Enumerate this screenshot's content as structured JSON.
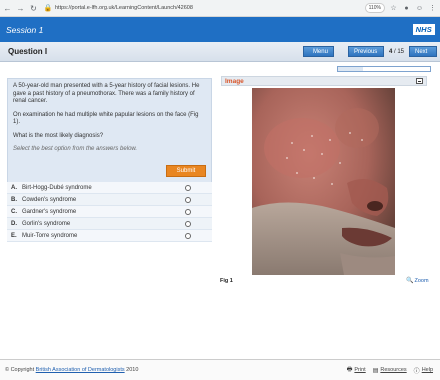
{
  "browser": {
    "url": "https://portal.e-lfh.org.uk/LearningContent/Launch/42608",
    "zoom": "110%"
  },
  "header": {
    "session_title": "Session 1",
    "logo_text": "NHS"
  },
  "question_bar": {
    "title": "Question I",
    "menu_label": "Menu",
    "previous_label": "Previous",
    "current_page": "4",
    "total_pages": "15",
    "next_label": "Next"
  },
  "progress": {
    "fraction": 0.2667
  },
  "question": {
    "paragraphs": [
      "A 50-year-old man presented with a 5-year history of facial lesions. He gave a past history of a pneumothorax. There was a family history of renal cancer.",
      "On examination he had multiple white papular lesions on the face (Fig 1).",
      "What is the most likely diagnosis?"
    ],
    "hint": "Select the best option from the answers below.",
    "submit_label": "Submit"
  },
  "answers": [
    {
      "letter": "A.",
      "text": "Birt-Hogg-Dubé syndrome"
    },
    {
      "letter": "B.",
      "text": "Cowden's syndrome"
    },
    {
      "letter": "C.",
      "text": "Gardner's syndrome"
    },
    {
      "letter": "D.",
      "text": "Gorlin's syndrome"
    },
    {
      "letter": "E.",
      "text": "Muir-Torre syndrome"
    }
  ],
  "image_panel": {
    "title": "Image",
    "caption": "Fig 1",
    "zoom_label": "Zoom"
  },
  "footer": {
    "copyright_prefix": "© Copyright",
    "copyright_link": "British Association of Dermatologists",
    "copyright_year": "2010",
    "print_label": "Print",
    "resources_label": "Resources",
    "help_label": "Help"
  },
  "colors": {
    "session_bar": "#1f6fc4",
    "button_blue": "#2f74bf",
    "submit_orange": "#e98621",
    "image_title": "#d9552a"
  }
}
